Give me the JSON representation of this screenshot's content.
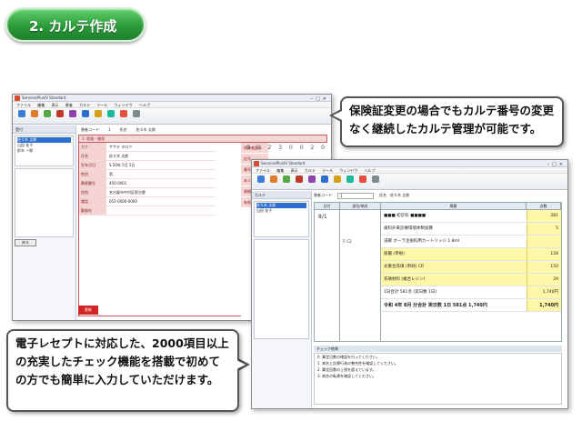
{
  "header": {
    "label": "2. カルテ作成"
  },
  "callouts": {
    "top": "保険証変更の場合でもカルテ番号の変更なく継続したカルテ管理が可能です。",
    "bottom": "電子レセプトに対応した、2000項目以上の充実したチェック機能を搭載で初めての方でも簡単に入力していただけます。"
  },
  "window1": {
    "title": "ServicesPlusIV Standard",
    "menu": [
      "ファイル",
      "編集",
      "表示",
      "患者",
      "カルテ",
      "ツール",
      "ウィンドウ",
      "ヘルプ"
    ],
    "side_header": "受付",
    "patients": [
      "佐々木 太郎",
      "山田 花子",
      "鈴木 一郎"
    ],
    "button": "戻る",
    "top_row": [
      "患者コード",
      "1",
      "氏名",
      "佐々木 太郎"
    ],
    "tab": "1. 保険・健保",
    "form_rows": [
      {
        "label": "カナ",
        "value": "ササキ タロウ"
      },
      {
        "label": "氏名",
        "value": "佐々木 太郎"
      },
      {
        "label": "生年月日",
        "value": "S 50年 5月 5日"
      },
      {
        "label": "性別",
        "value": "男"
      },
      {
        "label": "郵便番号",
        "value": "450-0001"
      },
      {
        "label": "住所",
        "value": "名古屋市中村区那古野"
      },
      {
        "label": "電話",
        "value": "052-0000-0000"
      },
      {
        "label": "勤務先",
        "value": ""
      }
    ],
    "right_labels": [
      "保険者番号",
      "記号",
      "番号",
      "本人家族",
      "資格取得",
      "有効期限"
    ],
    "digits": "0 1 2 3 0 0 2 0",
    "red_button": "更新"
  },
  "window2": {
    "title": "ServicesPlusIV Standard",
    "menu": [
      "ファイル",
      "編集",
      "表示",
      "カルテ",
      "ツール",
      "ウィンドウ",
      "ヘルプ"
    ],
    "side_header": "カルテ",
    "patients": [
      "佐々木 太郎",
      "山田 花子"
    ],
    "top_row": [
      "患者コード",
      "1",
      "氏名",
      "佐々木 太郎"
    ],
    "columns": [
      "日付",
      "部位/病名",
      "摘要",
      "点数"
    ],
    "date": "8/1",
    "sub": [
      "",
      "",
      "下 C2"
    ],
    "lines": [
      {
        "text": "■■■ 初診料 ■■■■",
        "num": "281",
        "yellow": false,
        "bold": false
      },
      {
        "text": "歯科外来診療環境体制加算",
        "num": "5",
        "yellow": false,
        "bold": false
      },
      {
        "text": "浸麻 オーラ注歯科用カートリッジ 1.8ml",
        "num": "",
        "yellow": false,
        "bold": false
      },
      {
        "text": "抜髄 (単根)",
        "num": "128",
        "yellow": true,
        "bold": false
      },
      {
        "text": "光重合充填 (単純) CR",
        "num": "150",
        "yellow": true,
        "bold": false
      },
      {
        "text": "充填材料 (複合レジン)",
        "num": "29",
        "yellow": true,
        "bold": false
      },
      {
        "text": "1日合計 581点 (実日数 1日)",
        "num": "1,740円",
        "yellow": false,
        "bold": false
      },
      {
        "text": "令和 4年 8月 分合計  実日数 1日 581点 1,740円",
        "num": "1,740円",
        "yellow": false,
        "bold": true
      }
    ],
    "msg_header": "チェック結果",
    "messages": [
      "0. 算定日数の確認を行ってください。",
      "1. 病名と診療行為の整合性を確認してください。",
      "2. 算定回数の上限を超えています。",
      "3. 病名の転帰を確認してください。"
    ]
  }
}
